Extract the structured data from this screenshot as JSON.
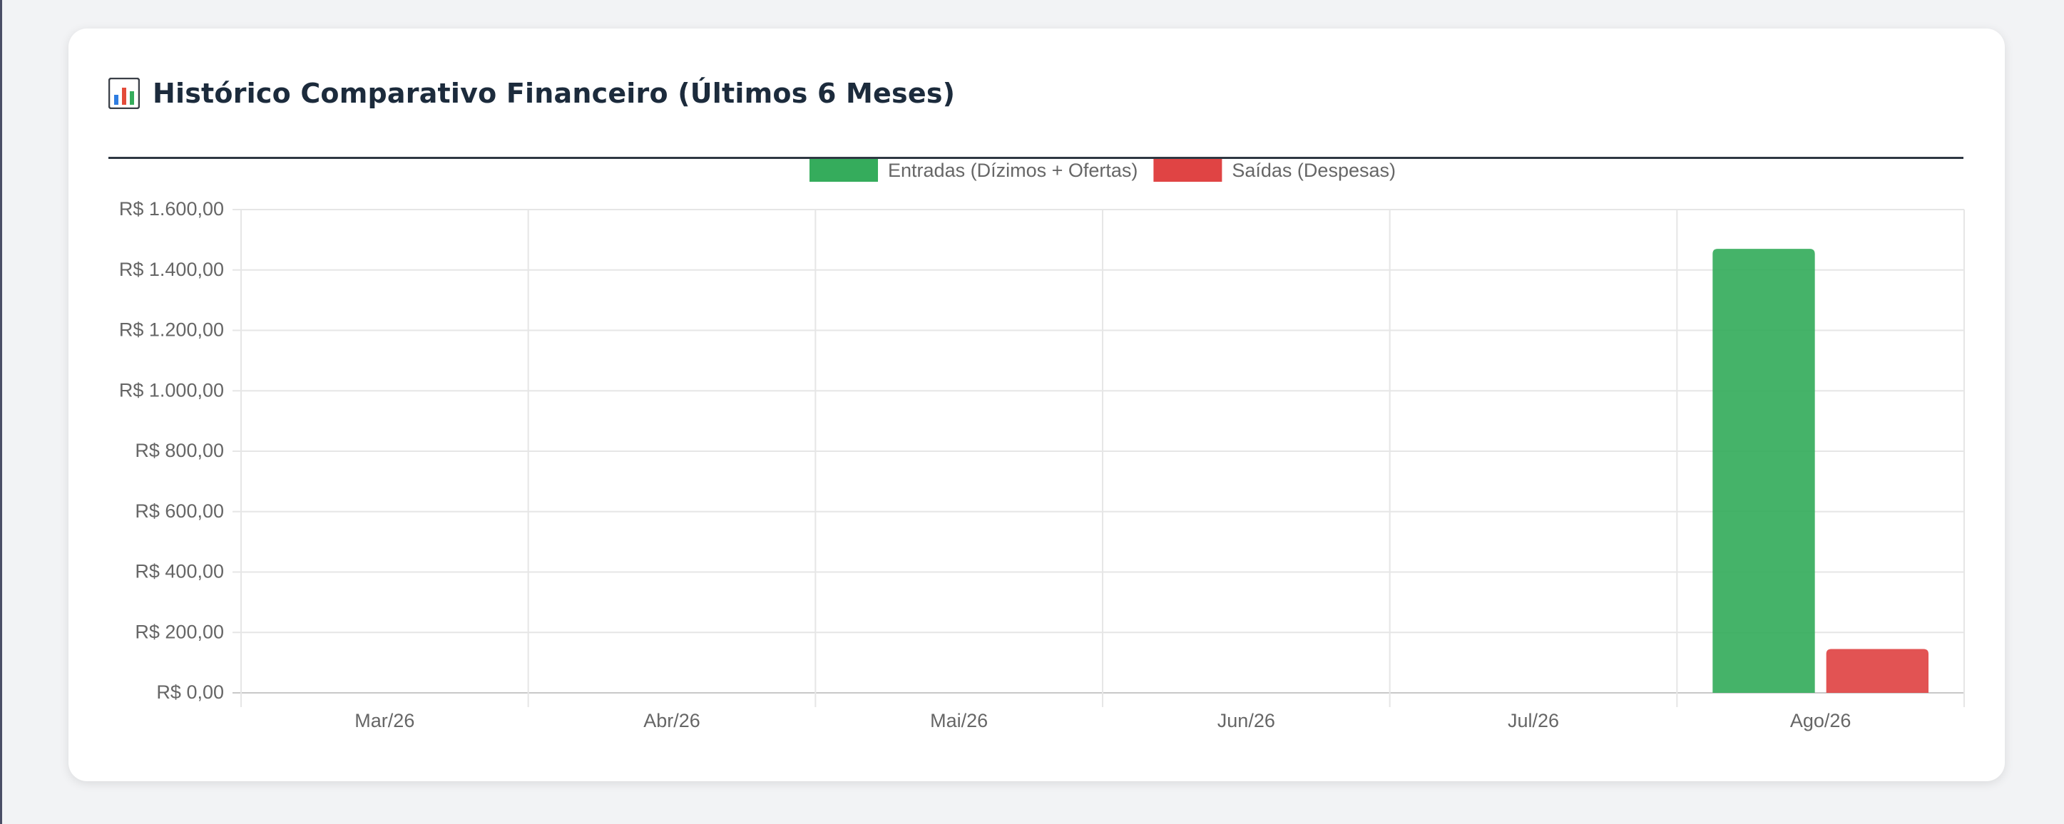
{
  "card": {
    "title": "Histórico Comparativo Financeiro (Últimos 6 Meses)",
    "title_icon": "bar-chart-icon"
  },
  "chart_data": {
    "type": "bar",
    "categories": [
      "Mar/26",
      "Abr/26",
      "Mai/26",
      "Jun/26",
      "Jul/26",
      "Ago/26"
    ],
    "series": [
      {
        "name": "Entradas (Dízimos + Ofertas)",
        "color": "#35ac5c",
        "values": [
          0,
          0,
          0,
          0,
          0,
          1470
        ]
      },
      {
        "name": "Saídas (Despesas)",
        "color": "#e04444",
        "values": [
          0,
          0,
          0,
          0,
          0,
          145
        ]
      }
    ],
    "ylim": [
      0,
      1600
    ],
    "yticks": [
      0,
      200,
      400,
      600,
      800,
      1000,
      1200,
      1400,
      1600
    ],
    "ytick_labels": [
      "R$ 0,00",
      "R$ 200,00",
      "R$ 400,00",
      "R$ 600,00",
      "R$ 800,00",
      "R$ 1.000,00",
      "R$ 1.200,00",
      "R$ 1.400,00",
      "R$ 1.600,00"
    ],
    "legend_position": "top-center",
    "grid": true
  }
}
